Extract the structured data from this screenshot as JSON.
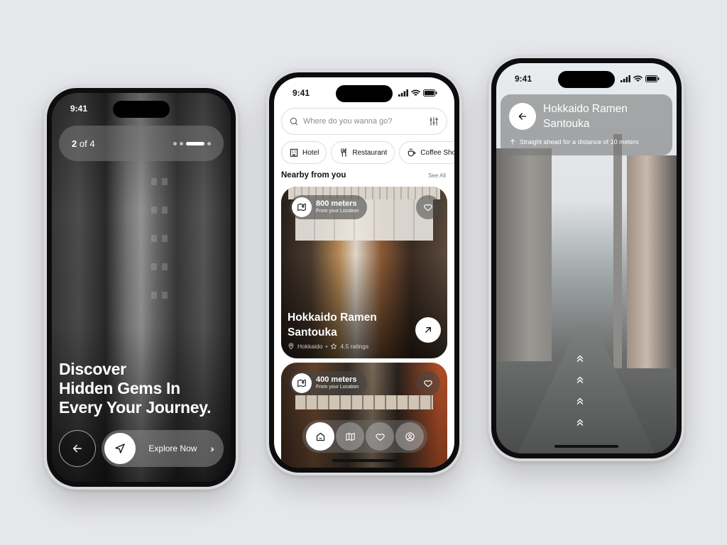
{
  "colors": {
    "accent": "#ffffff",
    "background": "#e6e7ea",
    "dark": "#111111"
  },
  "phone1": {
    "time": "9:41",
    "pager": {
      "current": "2",
      "separator": "of",
      "total": "4"
    },
    "hero": {
      "line1": "Discover",
      "line2": "Hidden Gems In",
      "line3": "Every Your Journey."
    },
    "explore_label": "Explore Now",
    "icons": {
      "back": "arrow-left-icon",
      "navigate": "navigation-arrow-icon",
      "chevrons": "double-chevron-right-icon"
    }
  },
  "phone2": {
    "time": "9:41",
    "search": {
      "placeholder": "Where do you wanna go?"
    },
    "chips": [
      {
        "label": "Hotel",
        "icon": "building-icon"
      },
      {
        "label": "Restaurant",
        "icon": "fork-knife-icon"
      },
      {
        "label": "Coffee Shop",
        "icon": "coffee-cup-icon"
      }
    ],
    "section": {
      "title": "Nearby from you",
      "see_all": "See All"
    },
    "cards": [
      {
        "distance": "800 meters",
        "distance_sub": "From your Location",
        "title_line1": "Hokkaido Ramen",
        "title_line2": "Santouka",
        "location": "Hokkaido",
        "rating": "4.5 ratings"
      },
      {
        "distance": "400 meters",
        "distance_sub": "From your Location"
      }
    ],
    "nav": [
      "home-icon",
      "map-icon",
      "heart-icon",
      "profile-icon"
    ]
  },
  "phone3": {
    "time": "9:41",
    "title_line1": "Hokkaido Ramen",
    "title_line2": "Santouka",
    "instruction": "Straight ahead for a distance of 10 meters"
  }
}
